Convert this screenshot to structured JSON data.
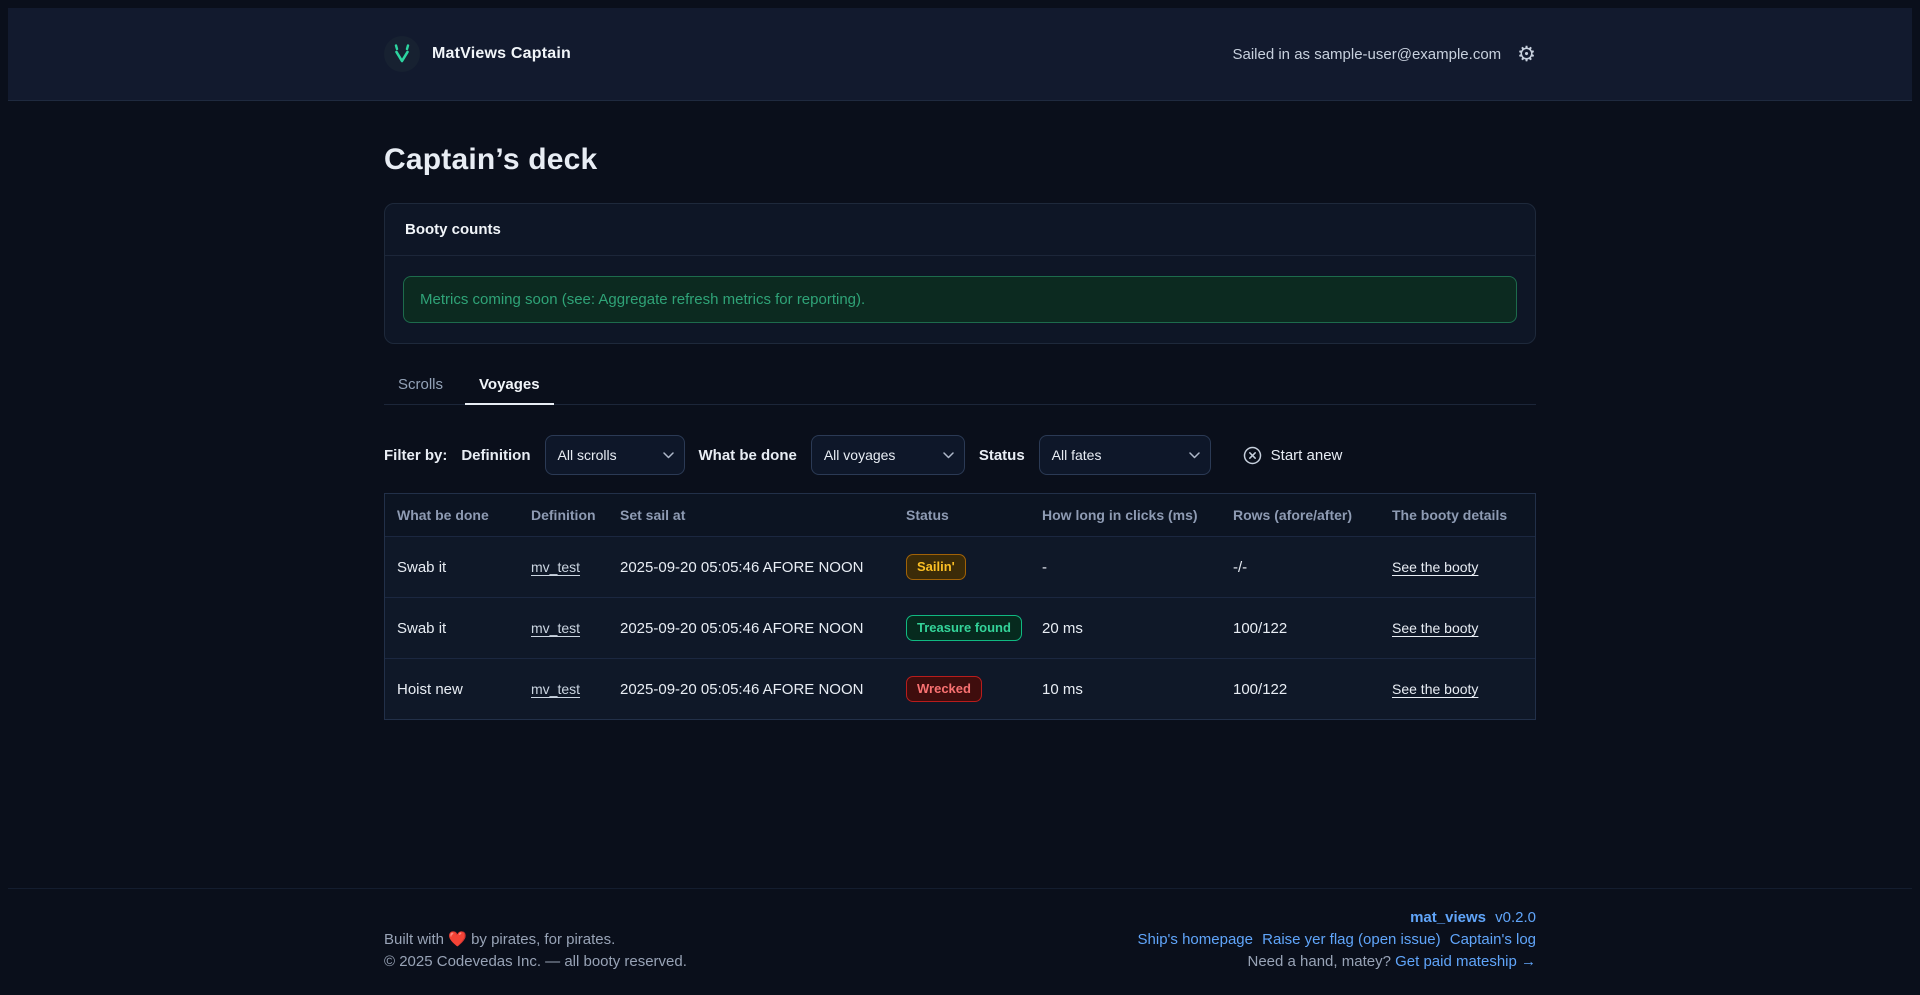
{
  "header": {
    "brand": "MatViews Captain",
    "user_status": "Sailed in as sample-user@example.com"
  },
  "page": {
    "title": "Captain’s deck"
  },
  "metrics_card": {
    "title": "Booty counts",
    "banner": "Metrics coming soon (see: Aggregate refresh metrics for reporting)."
  },
  "tabs": [
    {
      "label": "Scrolls",
      "active": false
    },
    {
      "label": "Voyages",
      "active": true
    }
  ],
  "filters": {
    "label": "Filter by:",
    "definition": {
      "label": "Definition",
      "value": "All scrolls"
    },
    "operation": {
      "label": "What be done",
      "value": "All voyages"
    },
    "status": {
      "label": "Status",
      "value": "All fates"
    },
    "reset_label": "Start anew"
  },
  "voyages_table": {
    "columns": [
      "What be done",
      "Definition",
      "Set sail at",
      "Status",
      "How long in clicks (ms)",
      "Rows (afore/after)",
      "The booty details"
    ],
    "rows": [
      {
        "operation": "Swab it",
        "definition": "mv_test",
        "set_sail_at": "2025-09-20 05:05:46 AFORE NOON",
        "status": {
          "label": "Sailin'",
          "variant": "running"
        },
        "duration": "-",
        "rows_afore_after": "-/-",
        "details_link": "See the booty"
      },
      {
        "operation": "Swab it",
        "definition": "mv_test",
        "set_sail_at": "2025-09-20 05:05:46 AFORE NOON",
        "status": {
          "label": "Treasure found",
          "variant": "success"
        },
        "duration": "20 ms",
        "rows_afore_after": "100/122",
        "details_link": "See the booty"
      },
      {
        "operation": "Hoist new",
        "definition": "mv_test",
        "set_sail_at": "2025-09-20 05:05:46 AFORE NOON",
        "status": {
          "label": "Wrecked",
          "variant": "failed"
        },
        "duration": "10 ms",
        "rows_afore_after": "100/122",
        "details_link": "See the booty"
      }
    ]
  },
  "footer": {
    "built_prefix": "Built with",
    "heart": "❤️",
    "built_suffix": "by pirates, for pirates.",
    "copyright": "© 2025 Codevedas Inc. — all booty reserved.",
    "product_name": "mat_views",
    "version": " v0.2.0",
    "links": [
      "Ship's homepage",
      "Raise yer flag (open issue)",
      "Captain's log"
    ],
    "support_prefix": "Need a hand, matey? ",
    "support_link": "Get paid mateship →"
  },
  "colors": {
    "header_bg": "#121a2e",
    "page_bg": "#0a0f1b",
    "accent_green": "#2dd4a0",
    "banner_text": "#2fa377",
    "banner_border": "#1d6b4c",
    "status_running": "#fbbf24",
    "status_success": "#34d399",
    "status_failed": "#f87171",
    "link_blue": "#60a5fa"
  }
}
